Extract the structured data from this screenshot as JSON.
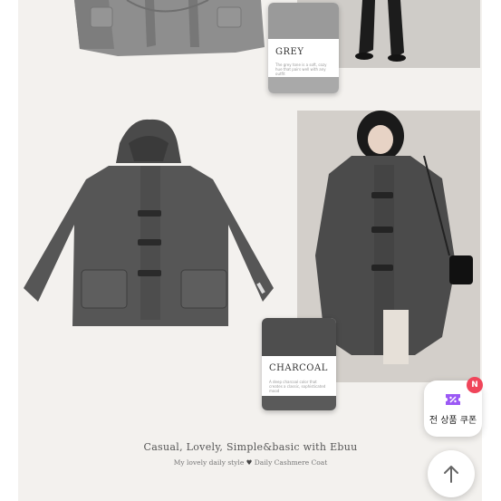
{
  "swatches": {
    "grey": {
      "name": "GREY",
      "desc": "The grey tone is a soft, cozy hue that pairs well with any outfit"
    },
    "charcoal": {
      "name": "CHARCOAL",
      "desc": "A deep charcoal color that creates a classic, sophisticated mood"
    }
  },
  "caption": {
    "main": "Casual, Lovely, Simple&basic with Ebuu",
    "sub_left": "My lovely daily style",
    "heart": "♥",
    "sub_right": "Daily Cashmere Coat"
  },
  "coupon": {
    "label": "전 상품 쿠폰",
    "badge": "N",
    "icon": "coupon-ticket-icon"
  },
  "scroll_top": {
    "icon": "arrow-up-icon"
  },
  "colors": {
    "grey_swatch": "#9a9a9a",
    "charcoal_swatch": "#4e4e4e",
    "coat": "#565656",
    "badge": "#f0455a",
    "coupon_icon": "#9b59f5"
  }
}
